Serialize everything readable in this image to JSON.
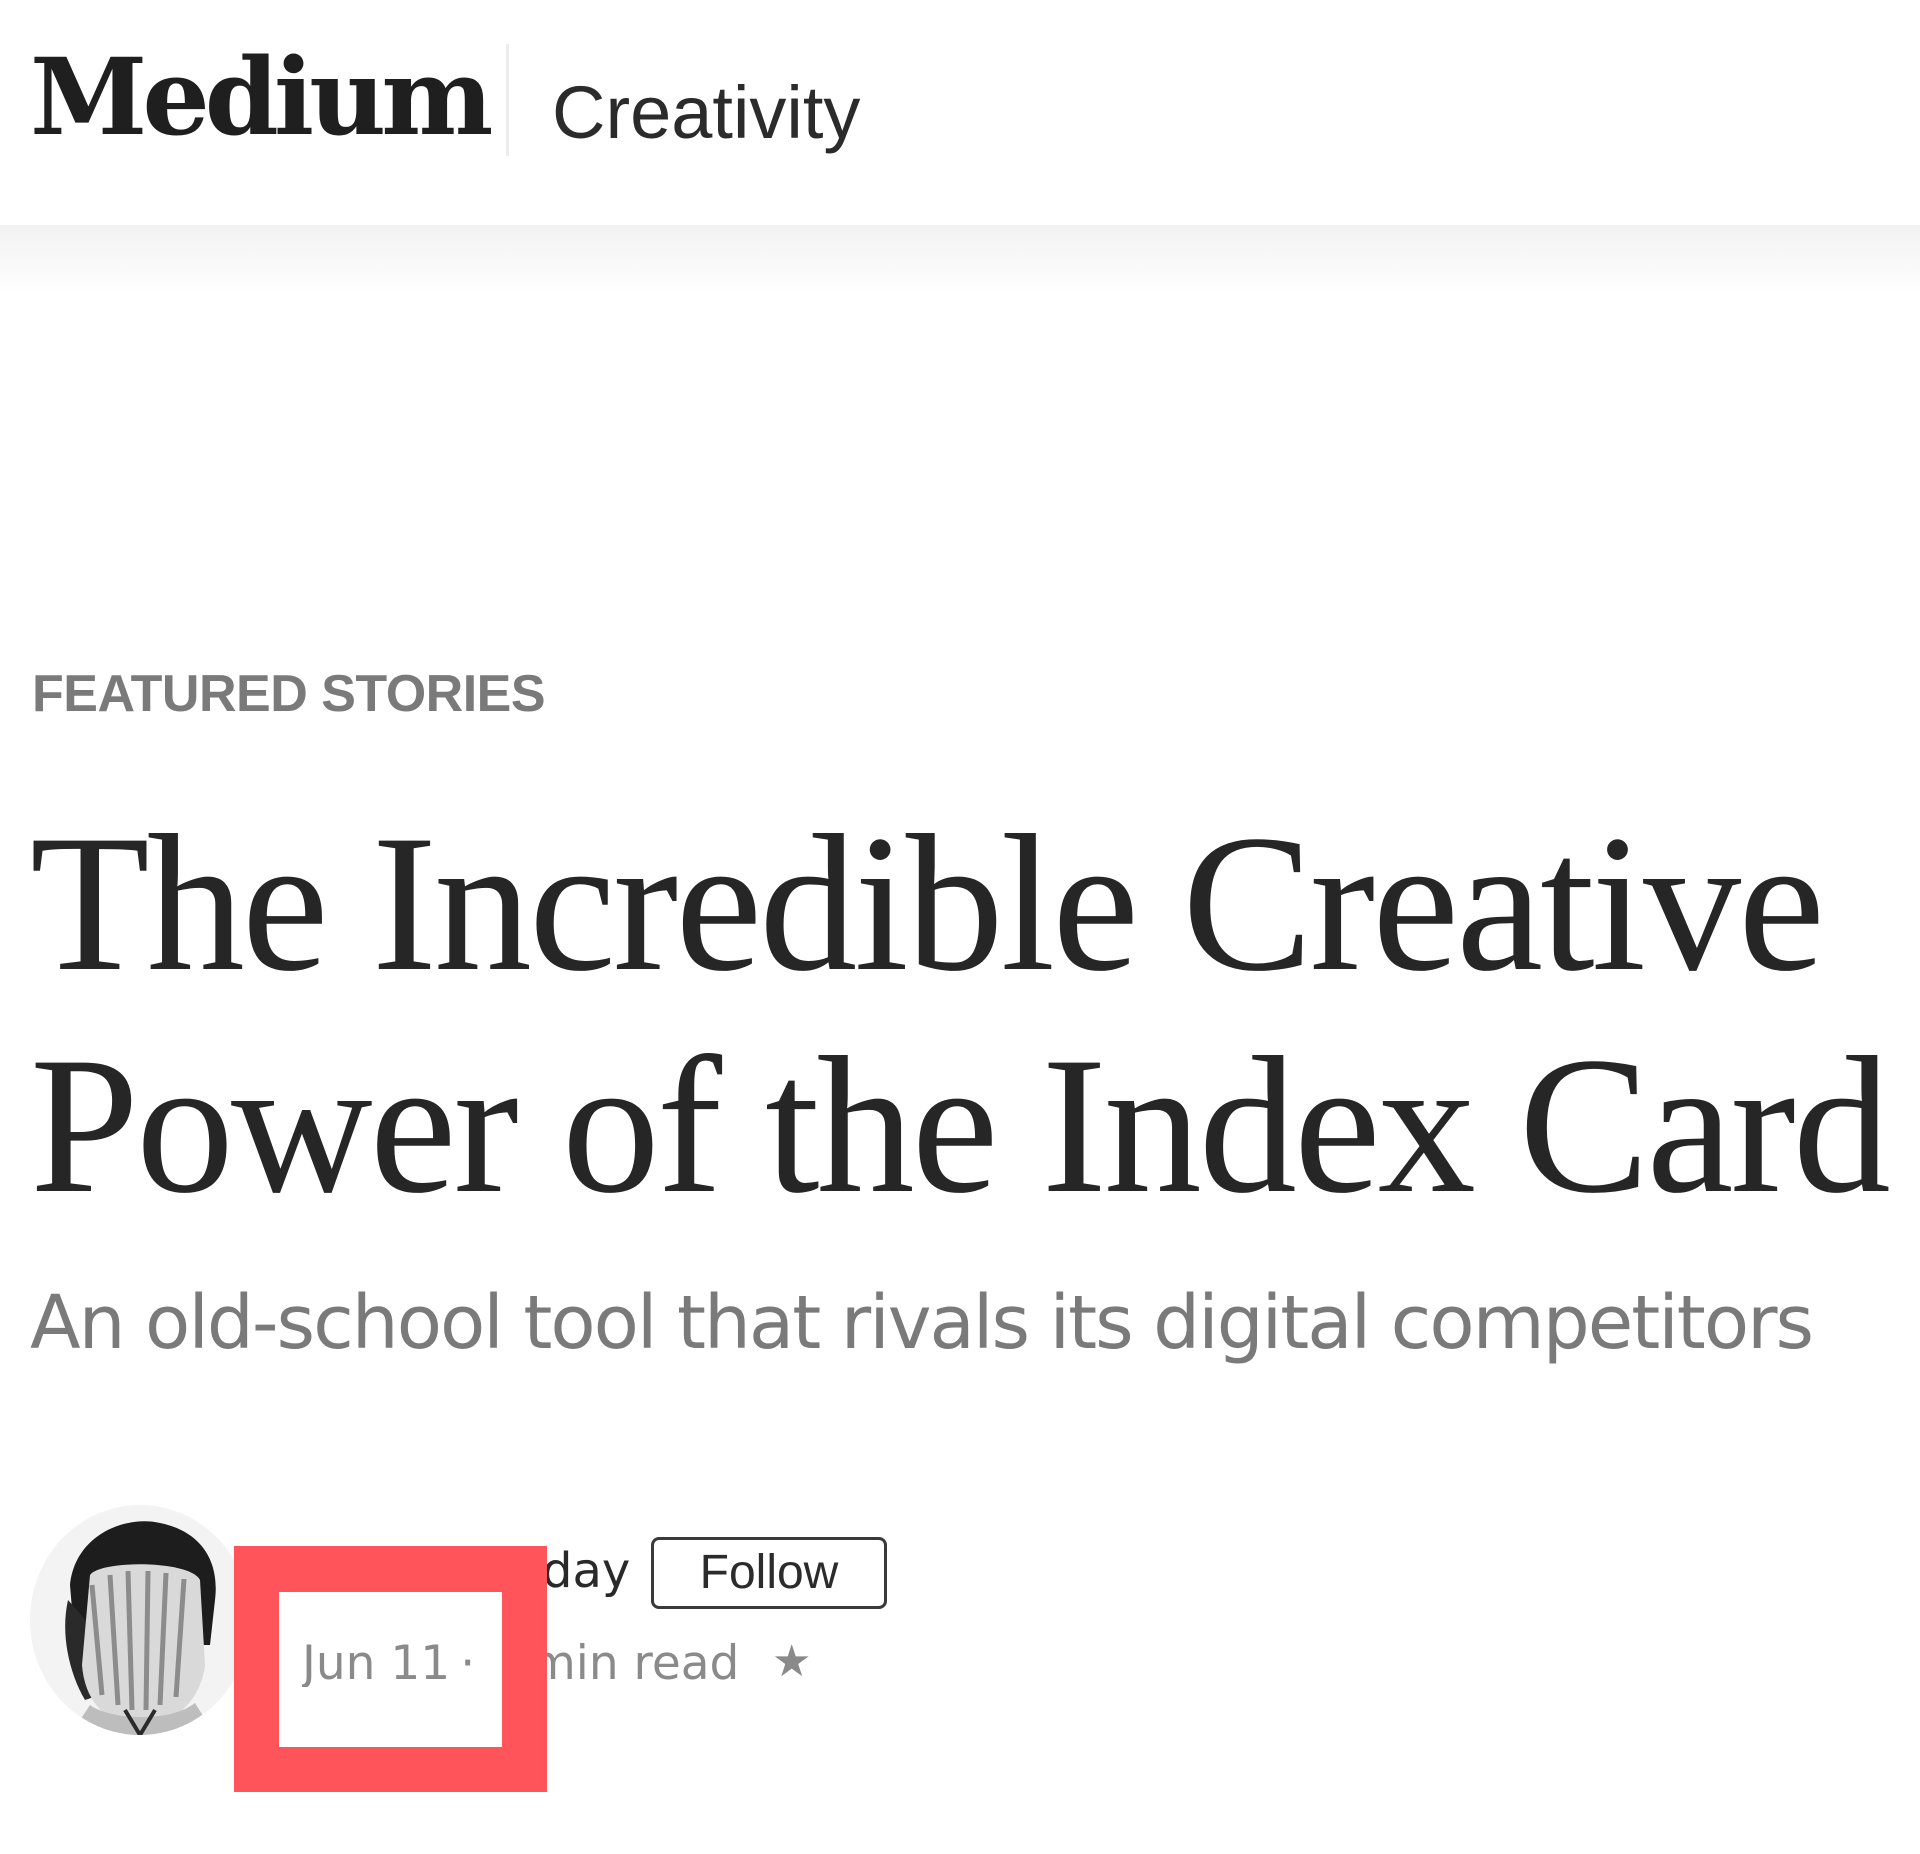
{
  "header": {
    "logo_text": "Medium",
    "section_label": "Creativity"
  },
  "article": {
    "kicker": "FEATURED STORIES",
    "title_line_1": "The Incredible Creative",
    "title_line_2": "Power of the Index Card",
    "subtitle": "An old-school tool that rivals its digital competitors"
  },
  "author": {
    "name_visible": "day",
    "follow_label": "Follow",
    "date": "Jun 11",
    "separator": "·",
    "read_time": "8 min read",
    "star_glyph": "★"
  },
  "colors": {
    "overlay_red": "#ff5459",
    "muted_text": "#8a8a8a",
    "title_text": "#262626"
  },
  "icons": {
    "member_star": "star-icon",
    "avatar": "author-avatar-photo"
  }
}
